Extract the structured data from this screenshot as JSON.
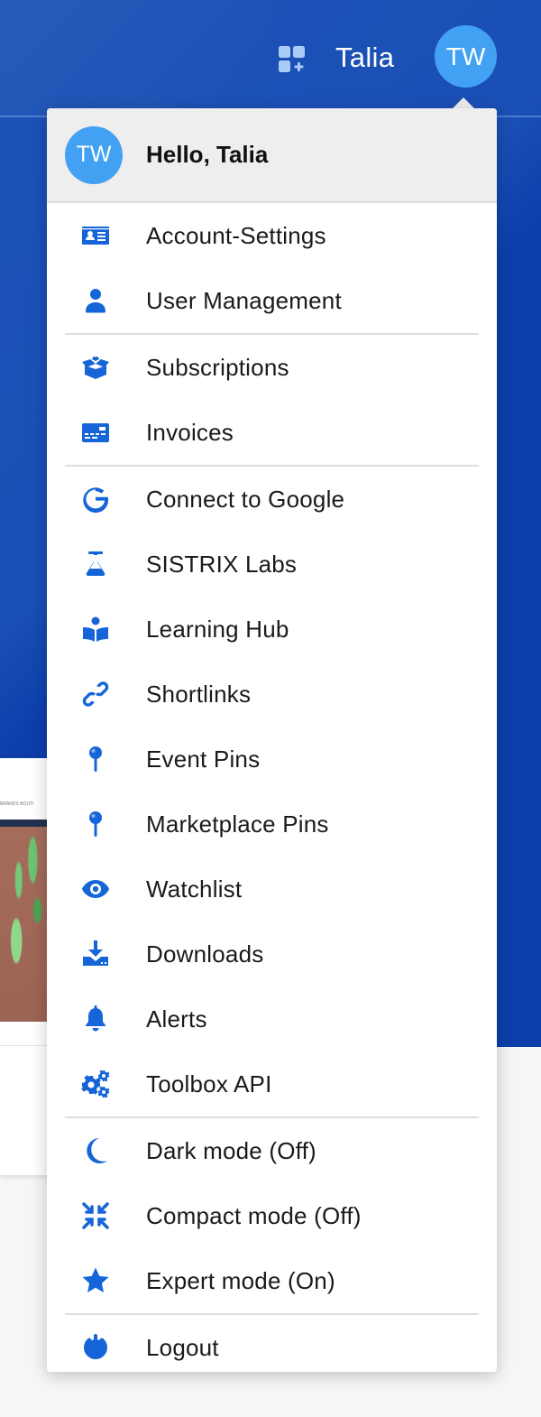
{
  "header": {
    "user_name": "Talia",
    "avatar_initials": "TW",
    "apps_icon": "apps-add-icon"
  },
  "background_card": {
    "nav_text": "BRANDS   BOUTI"
  },
  "menu": {
    "avatar_initials": "TW",
    "greeting": "Hello, Talia",
    "groups": [
      [
        {
          "label": "Account-Settings",
          "icon": "id-card-icon"
        },
        {
          "label": "User Management",
          "icon": "user-icon"
        }
      ],
      [
        {
          "label": "Subscriptions",
          "icon": "open-box-icon"
        },
        {
          "label": "Invoices",
          "icon": "credit-card-icon"
        }
      ],
      [
        {
          "label": "Connect to Google",
          "icon": "google-icon"
        },
        {
          "label": "SISTRIX Labs",
          "icon": "flask-icon"
        },
        {
          "label": "Learning Hub",
          "icon": "book-reader-icon"
        },
        {
          "label": "Shortlinks",
          "icon": "link-icon"
        },
        {
          "label": "Event Pins",
          "icon": "pin-icon"
        },
        {
          "label": "Marketplace Pins",
          "icon": "pin-icon"
        },
        {
          "label": "Watchlist",
          "icon": "eye-icon"
        },
        {
          "label": "Downloads",
          "icon": "download-icon"
        },
        {
          "label": "Alerts",
          "icon": "bell-icon"
        },
        {
          "label": "Toolbox API",
          "icon": "gears-icon"
        }
      ],
      [
        {
          "label": "Dark mode (Off)",
          "icon": "moon-icon"
        },
        {
          "label": "Compact mode (Off)",
          "icon": "compress-icon"
        },
        {
          "label": "Expert mode (On)",
          "icon": "star-icon"
        }
      ],
      [
        {
          "label": "Logout",
          "icon": "power-icon"
        }
      ]
    ]
  },
  "colors": {
    "brand_blue": "#0d3fab",
    "icon_blue": "#1565d8",
    "avatar_blue": "#42a1f2"
  }
}
